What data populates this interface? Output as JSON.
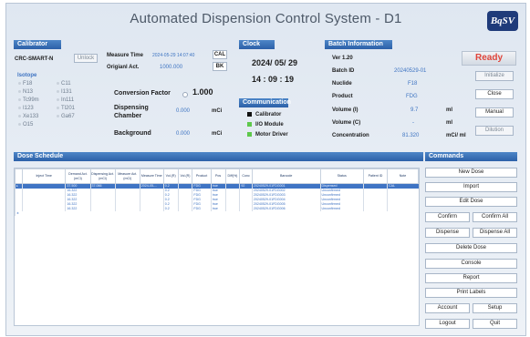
{
  "window": {
    "title": "Automated Dispension Control System - D1",
    "logo_text": "BqSV"
  },
  "calibrator": {
    "header": "Calibrator",
    "device": "CRC-SMART-N",
    "unlock_label": "Unlock",
    "measure_time_label": "Measure Time",
    "measure_time_value": "2024-05-29 14:07:40",
    "cal_label": "CAL",
    "original_act_label": "Origianl Act.",
    "original_act_value": "1000.000",
    "bk_label": "BK",
    "isotope_label": "Isotope",
    "isotopes_col1": [
      "F18",
      "N13",
      "Tc99m",
      "I123",
      "Xe133",
      "O15"
    ],
    "isotopes_col2": [
      "C11",
      "I131",
      "In111",
      "Tl201",
      "Ga67"
    ],
    "conversion_factor_label": "Conversion Factor",
    "conversion_factor_value": "1.000",
    "dispensing_chamber_label": "Dispensing Chamber",
    "dispensing_chamber_value": "0.000",
    "dispensing_chamber_unit": "mCi",
    "background_label": "Background",
    "background_value": "0.000",
    "background_unit": "mCi"
  },
  "clock": {
    "header": "Clock",
    "date": "2024/ 05/ 29",
    "time": "14 : 09 : 19"
  },
  "communication": {
    "header": "Communication",
    "items": [
      "Calibrator",
      "I/O Module",
      "Motor Driver"
    ]
  },
  "batch": {
    "header": "Batch Information",
    "version": "Ver 1.20",
    "batch_id_label": "Batch ID",
    "batch_id_value": "20240529-01",
    "nuclide_label": "Nuclide",
    "nuclide_value": "F18",
    "product_label": "Product",
    "product_value": "FDG",
    "volume_i_label": "Volume (I)",
    "volume_i_value": "9.7",
    "volume_i_unit": "ml",
    "volume_c_label": "Volume (C)",
    "volume_c_value": "-",
    "volume_c_unit": "ml",
    "concentration_label": "Concentration",
    "concentration_value": "81.320",
    "concentration_unit": "mCi/ ml"
  },
  "status": {
    "ready_label": "Ready",
    "initialize_label": "Initialize",
    "close_label": "Close",
    "manual_label": "Manual",
    "dilution_label": "Dilution"
  },
  "dose_schedule": {
    "header": "Dose Schedule",
    "columns": [
      "Inject Time",
      "Demand Act.(mCi)",
      "Dispensing Act.(mCi)",
      "Measure Act.(mCi)",
      "Measure Time",
      "Vol.(R)",
      "Vol.(R)",
      "Product",
      "Pos",
      "Diff(%)",
      "Conc",
      "Barcode",
      "Status",
      "Patient ID",
      "Note"
    ],
    "rows": [
      [
        "",
        "37.500",
        "37.066",
        "",
        "2024-05-...",
        "0.2",
        "",
        "FDG",
        "true",
        "",
        "92",
        "20240529-01FDG001",
        "Dispensed",
        "",
        "CAL"
      ],
      [
        "",
        "16.322",
        "",
        "",
        "",
        "0.2",
        "",
        "FDG",
        "true",
        "",
        "",
        "20240529-01FDG002",
        "Unconfirmed",
        "",
        ""
      ],
      [
        "",
        "16.322",
        "",
        "",
        "",
        "0.2",
        "",
        "FDG",
        "true",
        "",
        "",
        "20240529-01FDG003",
        "Unconfirmed",
        "",
        ""
      ],
      [
        "",
        "16.322",
        "",
        "",
        "",
        "0.2",
        "",
        "FDG",
        "true",
        "",
        "",
        "20240529-01FDG004",
        "Unconfirmed",
        "",
        ""
      ],
      [
        "",
        "16.322",
        "",
        "",
        "",
        "0.2",
        "",
        "FDG",
        "true",
        "",
        "",
        "20240529-01FDG005",
        "Unconfirmed",
        "",
        ""
      ],
      [
        "",
        "16.322",
        "",
        "",
        "",
        "0.2",
        "",
        "FDG",
        "true",
        "",
        "",
        "20240529-01FDG006",
        "Unconfirmed",
        "",
        ""
      ]
    ]
  },
  "commands": {
    "header": "Commands",
    "new_dose": "New Dose",
    "import": "Import",
    "edit_dose": "Edit Dose",
    "confirm": "Confirm",
    "confirm_all": "Confirm All",
    "dispense": "Dispense",
    "dispense_all": "Dispense All",
    "delete_dose": "Delete Dose",
    "console": "Console",
    "report": "Report",
    "print_labels": "Print Labels",
    "account": "Account",
    "setup": "Setup",
    "logout": "Logout",
    "quit": "Quit"
  },
  "colors": {
    "header_blue": "#3a72b8",
    "value_blue": "#3e74c2",
    "ready_red": "#e0443a",
    "led_green": "#5ec84b",
    "led_black": "#111111"
  }
}
